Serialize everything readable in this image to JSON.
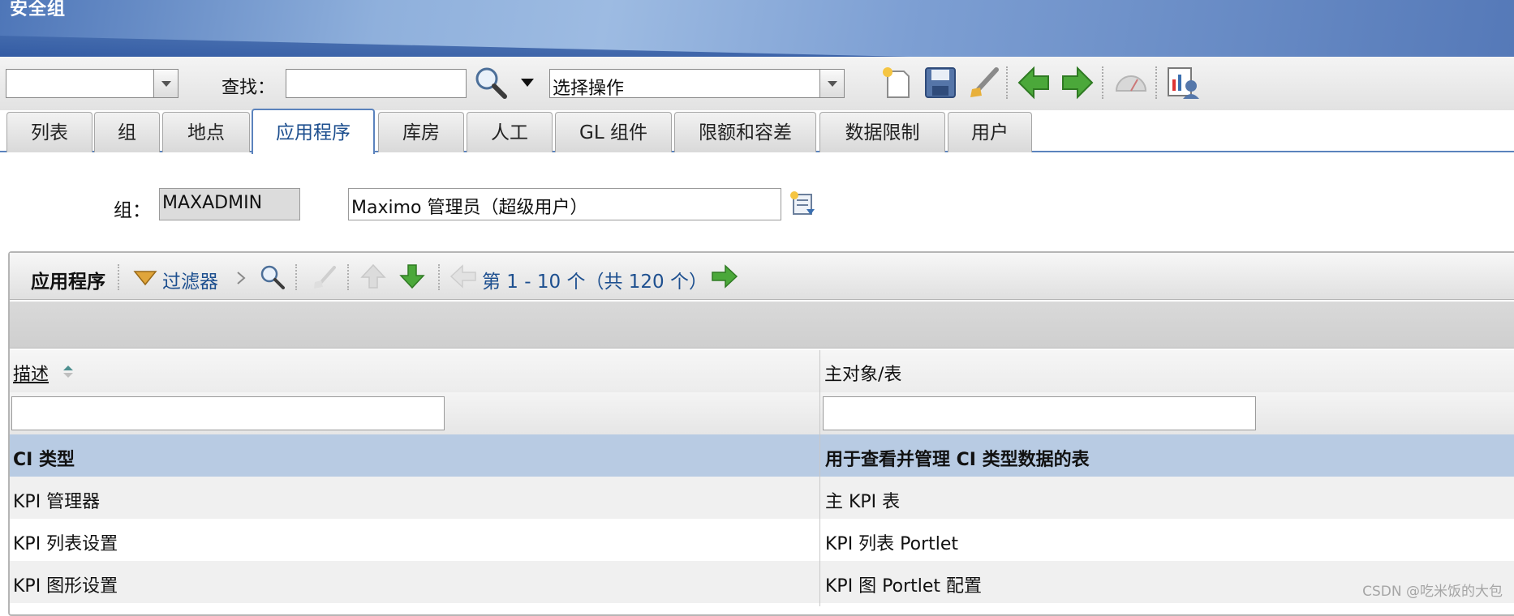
{
  "header": {
    "title": "安全组"
  },
  "toolbar": {
    "find_label": "查找：",
    "find_value": "",
    "action_select": "选择操作"
  },
  "tabs": [
    {
      "label": "列表"
    },
    {
      "label": "组"
    },
    {
      "label": "地点"
    },
    {
      "label": "应用程序"
    },
    {
      "label": "库房"
    },
    {
      "label": "人工"
    },
    {
      "label": "GL 组件"
    },
    {
      "label": "限额和容差"
    },
    {
      "label": "数据限制"
    },
    {
      "label": "用户"
    }
  ],
  "active_tab": "应用程序",
  "group": {
    "label": "组：",
    "id": "MAXADMIN",
    "description": "Maximo 管理员（超级用户）"
  },
  "table": {
    "title": "应用程序",
    "filter_label": "过滤器",
    "paging": "第 1 - 10 个（共 120 个）",
    "columns": [
      "描述",
      "主对象/表"
    ],
    "rows": [
      {
        "desc": "CI 类型",
        "main": "用于查看并管理 CI 类型数据的表",
        "selected": true
      },
      {
        "desc": "KPI 管理器",
        "main": "主 KPI 表"
      },
      {
        "desc": "KPI 列表设置",
        "main": "KPI 列表 Portlet"
      },
      {
        "desc": "KPI 图形设置",
        "main": "KPI 图 Portlet 配置"
      }
    ]
  },
  "watermark": "CSDN @吃米饭的大包",
  "colors": {
    "banner": "#5b83bd",
    "selected_row": "#b8cbe3",
    "link_text": "#1d4f8f",
    "nav_arrow_green": "#3f9a2e"
  },
  "icons": [
    "chevron-down-icon",
    "search-icon",
    "new-record-icon",
    "save-icon",
    "clear-icon",
    "previous-record-icon",
    "next-record-icon",
    "gauge-icon",
    "report-icon",
    "detail-menu-icon",
    "filter-icon",
    "arrow-up-icon",
    "arrow-down-icon",
    "arrow-left-icon",
    "arrow-right-icon"
  ]
}
